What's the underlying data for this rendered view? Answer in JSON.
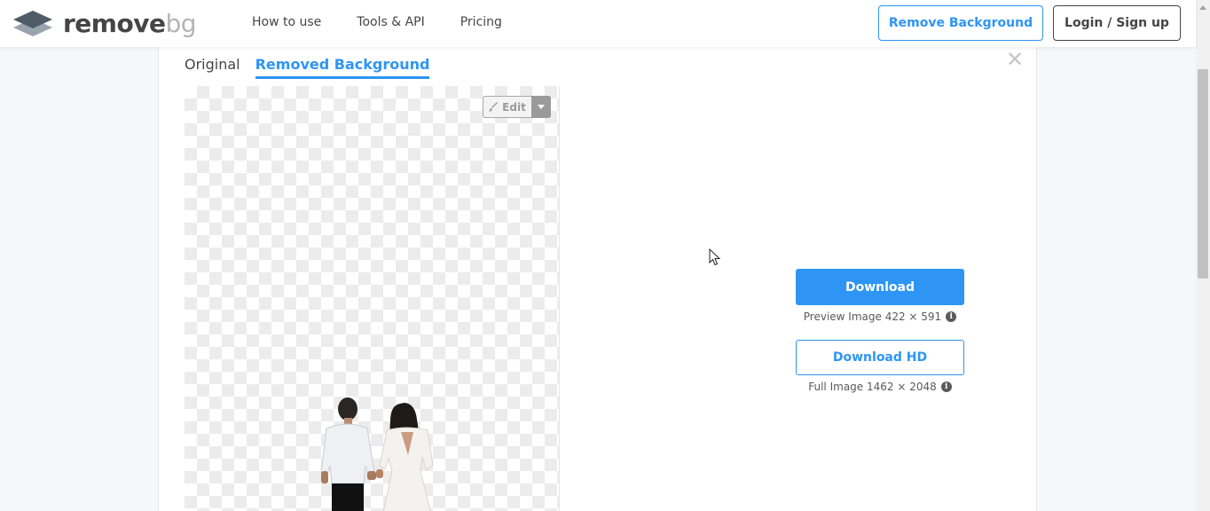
{
  "header": {
    "logo": {
      "word1": "remove",
      "word2": "bg"
    },
    "nav": [
      {
        "label": "How to use"
      },
      {
        "label": "Tools & API"
      },
      {
        "label": "Pricing"
      }
    ],
    "remove_background_label": "Remove Background",
    "login_label": "Login / Sign up"
  },
  "tabs": [
    {
      "label": "Original",
      "active": false
    },
    {
      "label": "Removed Background",
      "active": true
    }
  ],
  "preview": {
    "edit_label": "Edit"
  },
  "download": {
    "button_label": "Download",
    "preview_info": "Preview Image 422 × 591",
    "hd_button_label": "Download HD",
    "full_info": "Full Image 1462 × 2048"
  },
  "icons": {
    "close": "close-icon",
    "edit": "brush-icon",
    "caret": "chevron-down-icon",
    "info": "info-icon"
  },
  "colors": {
    "accent": "#2e95f4",
    "text": "#454545",
    "logo_secondary": "#b4b4b4",
    "background": "#f6f7f8"
  }
}
